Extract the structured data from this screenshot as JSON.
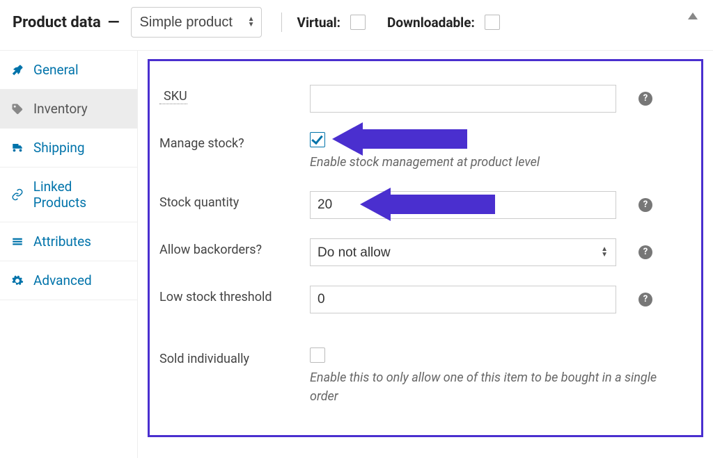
{
  "header": {
    "title": "Product data",
    "dash": "—",
    "product_type_selected": "Simple product",
    "virtual_label": "Virtual:",
    "virtual_checked": false,
    "downloadable_label": "Downloadable:",
    "downloadable_checked": false
  },
  "tabs": [
    {
      "id": "general",
      "label": "General",
      "icon": "wrench-icon",
      "active": false
    },
    {
      "id": "inventory",
      "label": "Inventory",
      "icon": "price-tag-icon",
      "active": true
    },
    {
      "id": "shipping",
      "label": "Shipping",
      "icon": "truck-icon",
      "active": false
    },
    {
      "id": "linked",
      "label": "Linked Products",
      "icon": "link-icon",
      "active": false
    },
    {
      "id": "attributes",
      "label": "Attributes",
      "icon": "list-icon",
      "active": false
    },
    {
      "id": "advanced",
      "label": "Advanced",
      "icon": "gear-icon",
      "active": false
    }
  ],
  "fields": {
    "sku": {
      "label": "SKU",
      "value": ""
    },
    "manage_stock": {
      "label": "Manage stock?",
      "checked": true,
      "description": "Enable stock management at product level"
    },
    "stock_quantity": {
      "label": "Stock quantity",
      "value": "20"
    },
    "allow_backorders": {
      "label": "Allow backorders?",
      "selected": "Do not allow"
    },
    "low_stock_threshold": {
      "label": "Low stock threshold",
      "value": "0"
    },
    "sold_individually": {
      "label": "Sold individually",
      "checked": false,
      "description": "Enable this to only allow one of this item to be bought in a single order"
    }
  },
  "annotation_color": "#4a2fcf"
}
